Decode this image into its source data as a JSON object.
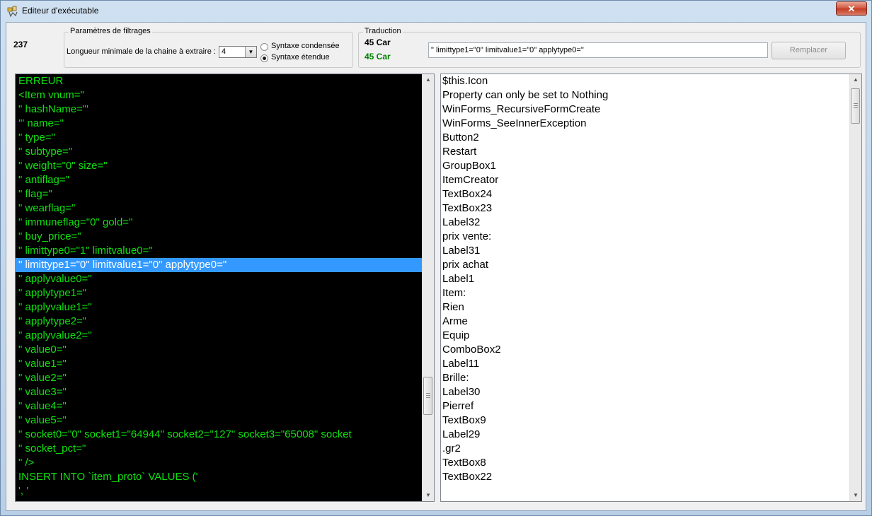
{
  "window": {
    "title": "Editeur d'exécutable",
    "close_glyph": "✕"
  },
  "count": "237",
  "filter": {
    "legend": "Paramètres de filtrages",
    "min_length_label": "Longueur minimale de la chaine à extraire :",
    "min_length_value": "4",
    "radio_condensed": "Syntaxe condensée",
    "radio_extended": "Syntaxe étendue",
    "selected_radio": "extended"
  },
  "translation": {
    "legend": "Traduction",
    "count_a": "45 Car",
    "count_b": "45 Car",
    "count_a_color": "#000000",
    "count_b_color": "#008000",
    "text_value": "\" limittype1=\"0\" limitvalue1=\"0\" applytype0=\"",
    "replace_label": "Remplacer"
  },
  "left_list": {
    "selected_index": 13,
    "items": [
      "ERREUR",
      "<Item vnum=\"",
      "\" hashName=\"'",
      "'\" name=\"",
      "\" type=\"",
      "\" subtype=\"",
      "\" weight=\"0\" size=\"",
      "\" antiflag=\"",
      "\" flag=\"",
      "\" wearflag=\"",
      "\" immuneflag=\"0\" gold=\"",
      "\" buy_price=\"",
      "\" limittype0=\"1\" limitvalue0=\"",
      "\" limittype1=\"0\" limitvalue1=\"0\" applytype0=\"",
      "\" applyvalue0=\"",
      "\" applytype1=\"",
      "\" applyvalue1=\"",
      "\" applytype2=\"",
      "\" applyvalue2=\"",
      "\" value0=\"",
      "\" value1=\"",
      "\" value2=\"",
      "\" value3=\"",
      "\" value4=\"",
      "\" value5=\"",
      "\" socket0=\"0\" socket1=\"64944\" socket2=\"127\" socket3=\"65008\" socket",
      "\" socket_pct=\"",
      "\" />",
      "INSERT INTO `item_proto` VALUES ('",
      "', '"
    ]
  },
  "right_list": {
    "items": [
      "$this.Icon",
      "Property can only be set to Nothing",
      "WinForms_RecursiveFormCreate",
      "WinForms_SeeInnerException",
      "Button2",
      "Restart",
      "GroupBox1",
      "ItemCreator",
      "TextBox24",
      "TextBox23",
      "Label32",
      "prix vente:",
      "Label31",
      "prix achat",
      "Label1",
      "Item:",
      "Rien",
      "Arme",
      "Equip",
      "ComboBox2",
      "Label11",
      "Brille:",
      "Label30",
      "Pierref",
      "TextBox9",
      "Label29",
      ".gr2",
      "TextBox8",
      "TextBox22"
    ]
  },
  "icons": {
    "scroll_up": "▲",
    "scroll_down": "▼",
    "combo_arrow": "▼"
  }
}
